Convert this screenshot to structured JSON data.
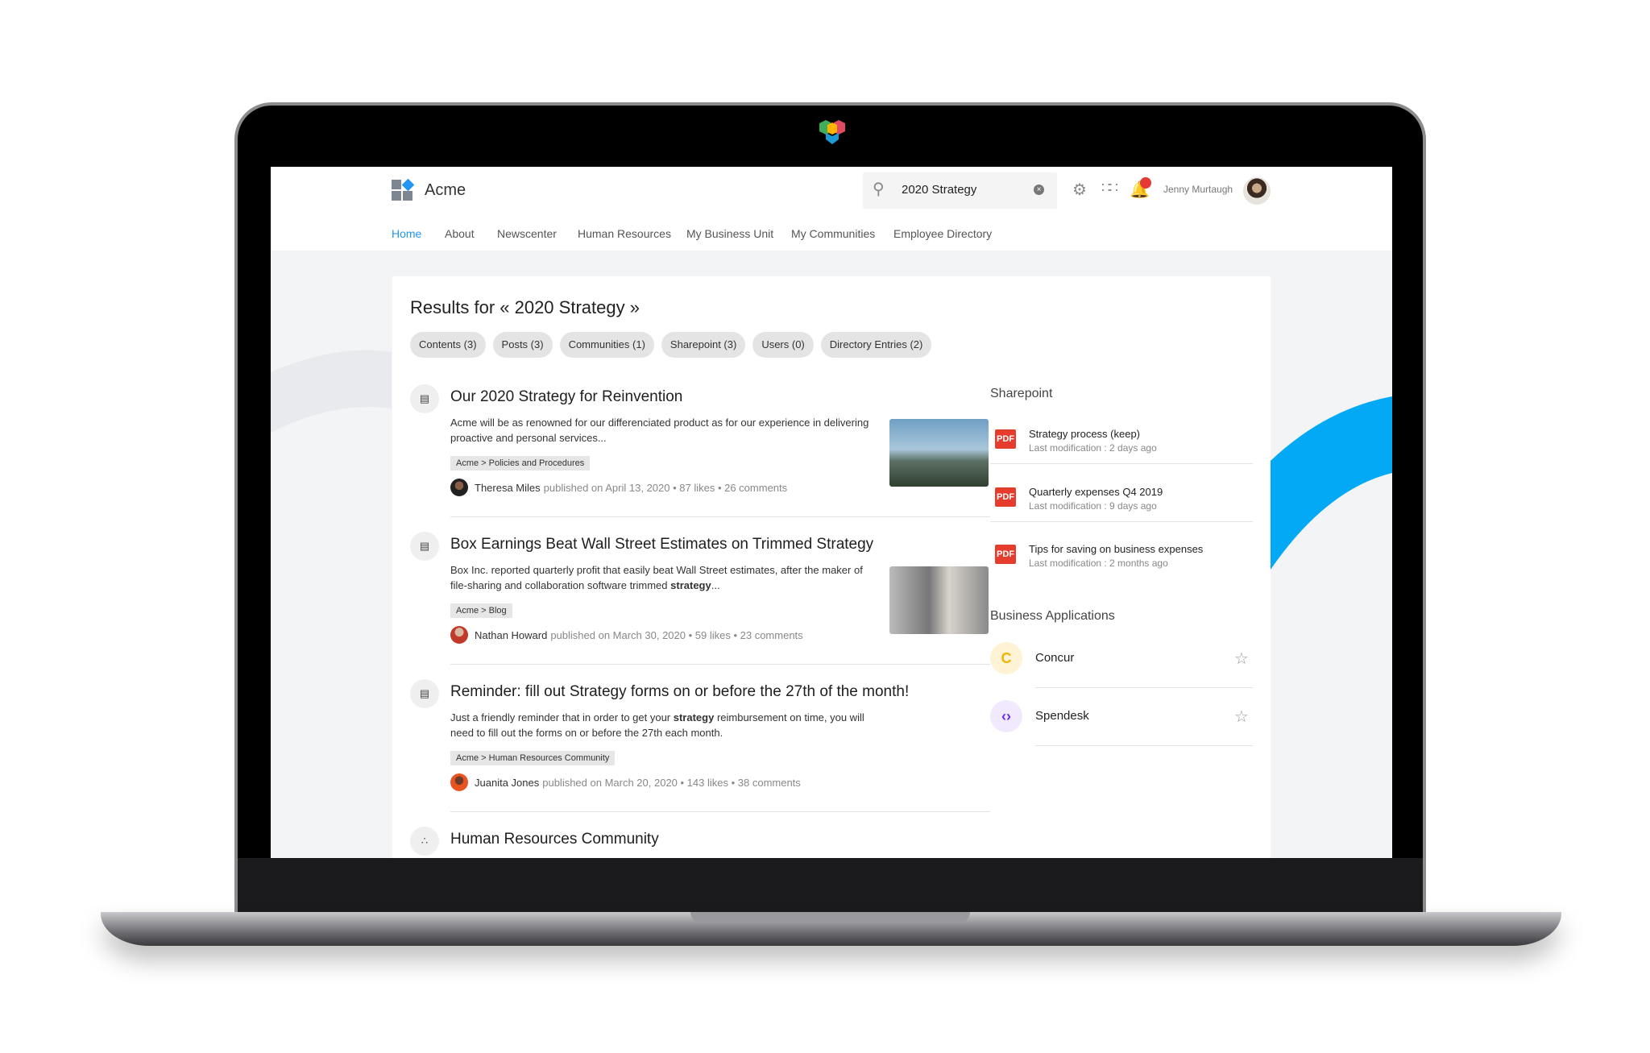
{
  "header": {
    "brand": "Acme",
    "search_value": "2020 Strategy",
    "user_name": "Jenny Murtaugh",
    "accent": "#2196f3",
    "notification_color": "#e53935"
  },
  "nav": [
    {
      "label": "Home",
      "active": true
    },
    {
      "label": "About"
    },
    {
      "label": "Newscenter"
    },
    {
      "label": "Human Resources"
    },
    {
      "label": "My Business Unit"
    },
    {
      "label": "My Communities"
    },
    {
      "label": "Employee Directory"
    }
  ],
  "results": {
    "title": "Results for « 2020 Strategy »",
    "filters": [
      "Contents (3)",
      "Posts (3)",
      "Communities (1)",
      "Sharepoint (3)",
      "Users (0)",
      "Directory Entries (2)"
    ],
    "items": [
      {
        "icon": "document-icon",
        "title": "Our 2020 Strategy for Reinvention",
        "desc": "Acme will be as renowned for our differenciated product as for our experience in delivering proactive and personal services...",
        "tag": "Acme > Policies and Procedures",
        "author": "Theresa Miles",
        "meta": "published on April 13, 2020 •  87 likes • 26 comments"
      },
      {
        "icon": "document-icon",
        "title": "Box Earnings Beat Wall Street Estimates on Trimmed Strategy",
        "desc_pre": "Box Inc. reported quarterly profit that easily beat Wall Street estimates, after the maker of file-sharing and collaboration software trimmed ",
        "desc_bold": "strategy",
        "desc_post": "...",
        "tag": "Acme > Blog",
        "author": "Nathan Howard",
        "meta": "published on March 30, 2020 • 59 likes • 23 comments"
      },
      {
        "icon": "post-icon",
        "title": "Reminder: fill out Strategy forms on or before the 27th of the month!",
        "desc_pre": "Just a friendly reminder that in order to get your ",
        "desc_bold": "strategy",
        "desc_post": " reimbursement on time, you will need to fill out the forms on or before the 27th each month.",
        "tag": "Acme > Human Resources Community",
        "author": "Juanita Jones",
        "meta": "published on March 20, 2020 • 143 likes • 38 comments"
      },
      {
        "icon": "community-icon",
        "title": "Human Resources Community"
      }
    ]
  },
  "sharepoint": {
    "title": "Sharepoint",
    "badge": "PDF",
    "items": [
      {
        "name": "Strategy process (keep)",
        "sub": "Last modification : 2 days ago"
      },
      {
        "name": "Quarterly expenses Q4 2019",
        "sub": "Last modification : 9 days ago"
      },
      {
        "name": "Tips for saving on business expenses",
        "sub": "Last modification : 2 months ago"
      }
    ]
  },
  "apps": {
    "title": "Business Applications",
    "items": [
      {
        "name": "Concur",
        "icon": "C",
        "color": "#f5b301"
      },
      {
        "name": "Spendesk",
        "icon": "‹›",
        "color": "#6a2cf0"
      }
    ]
  }
}
